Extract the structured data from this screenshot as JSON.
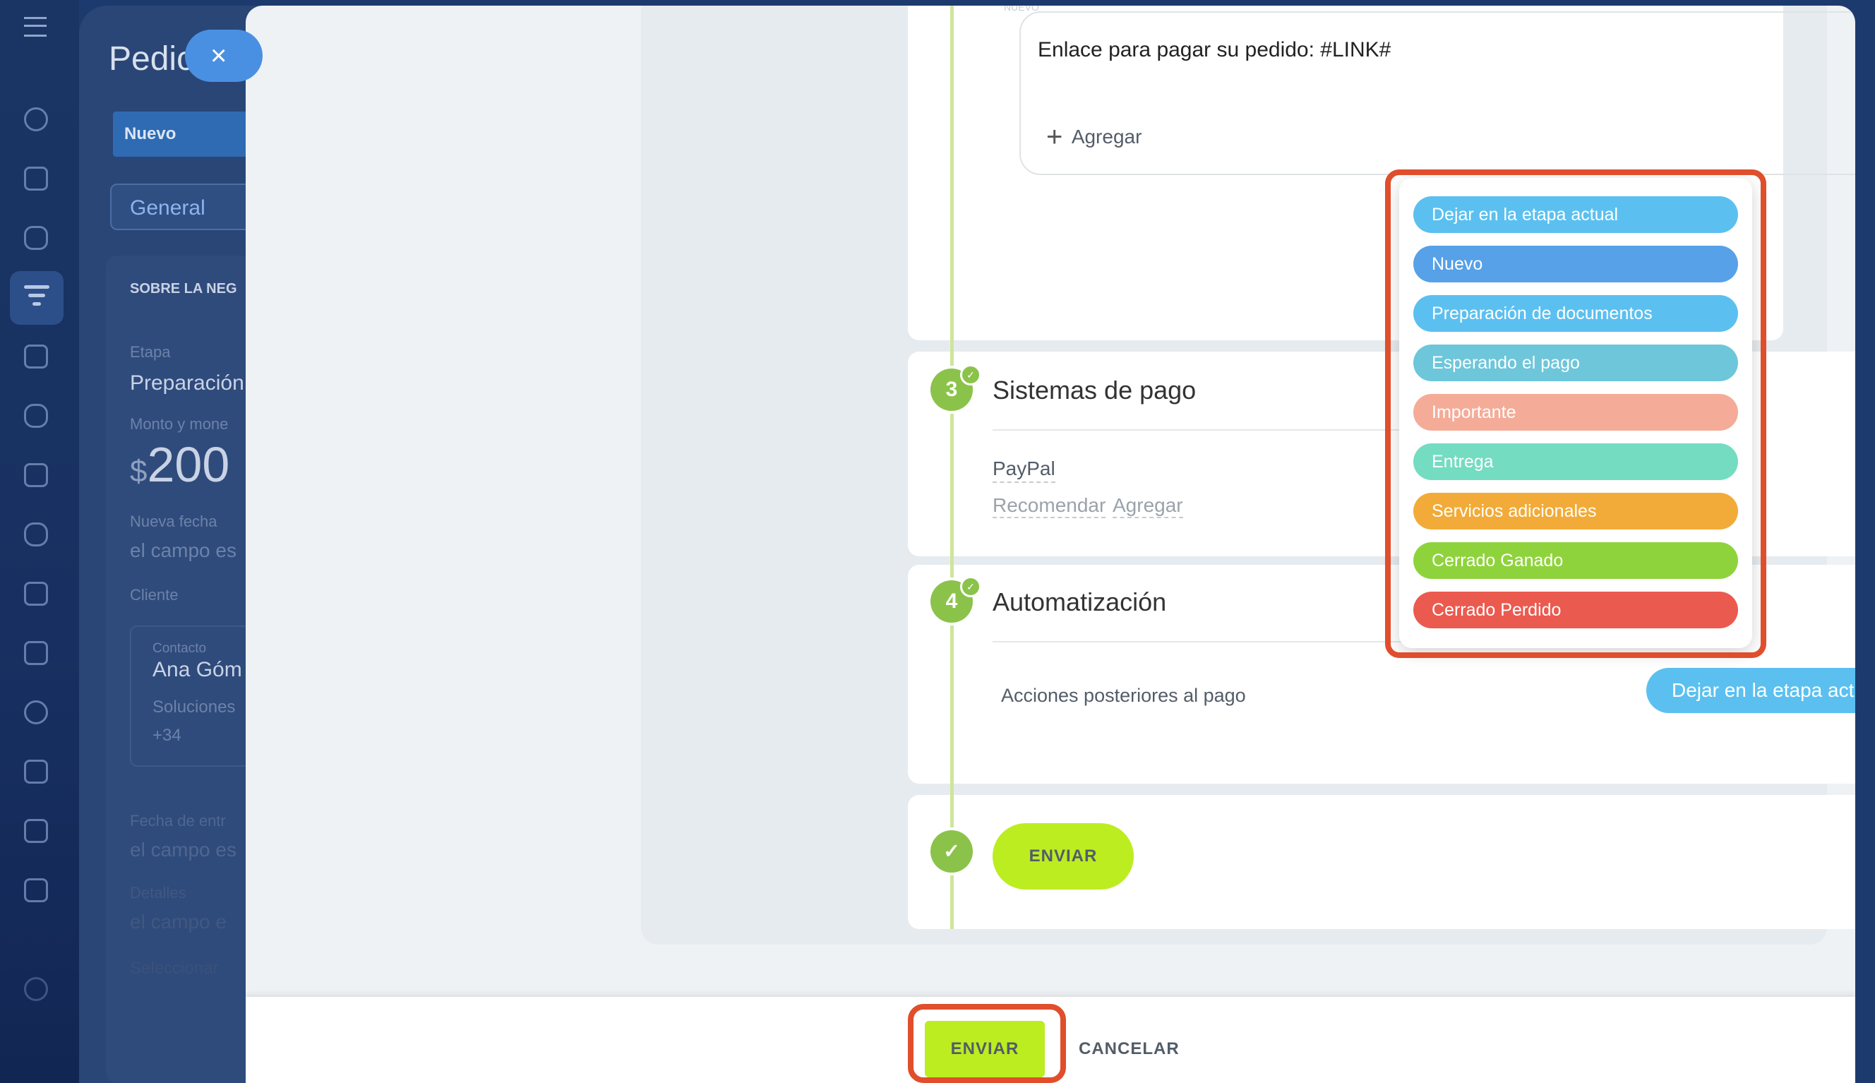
{
  "background_page": {
    "title": "Pedic",
    "stage_button": "Nuevo",
    "tab_general": "General",
    "section_label": "SOBRE LA NEG",
    "field_stage_label": "Etapa",
    "field_stage_value": "Preparación",
    "field_amount_label": "Monto y mone",
    "amount_currency": "$",
    "amount_value": "200",
    "field_date_label": "Nueva fecha",
    "field_date_value": "el campo es",
    "field_client_label": "Cliente",
    "contact_label": "Contacto",
    "contact_name": "Ana Góm",
    "contact_company": "Soluciones",
    "contact_phone": "+34",
    "field_delivery_label": "Fecha de entr",
    "field_delivery_value": "el campo es",
    "field_details_label": "Detalles",
    "field_details_value": "el campo e",
    "select_label": "Seleccionar"
  },
  "message": {
    "small_label": "NUEVO",
    "text": "Enlace para pagar su pedido: #LINK#",
    "add_label": "Agregar"
  },
  "section3": {
    "number": "3",
    "title": "Sistemas de pago",
    "payment_system": "PayPal",
    "recommend_link": "Recomendar",
    "add_link": "Agregar"
  },
  "section4": {
    "number": "4",
    "title": "Automatización",
    "action_label": "Acciones posteriores al pago",
    "selected_value": "Dejar en la etapa actual"
  },
  "send_section": {
    "button": "ENVIAR"
  },
  "dropdown": {
    "options": [
      {
        "label": "Dejar en la etapa actual",
        "color": "#5bc0f0"
      },
      {
        "label": "Nuevo",
        "color": "#56a1e8"
      },
      {
        "label": "Preparación de documentos",
        "color": "#5bc0f0"
      },
      {
        "label": "Esperando el pago",
        "color": "#6ec6da"
      },
      {
        "label": "Importante",
        "color": "#f4ac98"
      },
      {
        "label": "Entrega",
        "color": "#74dcc1"
      },
      {
        "label": "Servicios adicionales",
        "color": "#f2ab38"
      },
      {
        "label": "Cerrado Ganado",
        "color": "#8fd33c"
      },
      {
        "label": "Cerrado Perdido",
        "color": "#eb5a4f"
      }
    ]
  },
  "footer": {
    "send": "ENVIAR",
    "cancel": "CANCELAR"
  },
  "colors": {
    "accent_green": "#bbed21",
    "step_green": "#8bc34a",
    "highlight": "#e04e2c",
    "select_blue": "#5bc0f0"
  }
}
